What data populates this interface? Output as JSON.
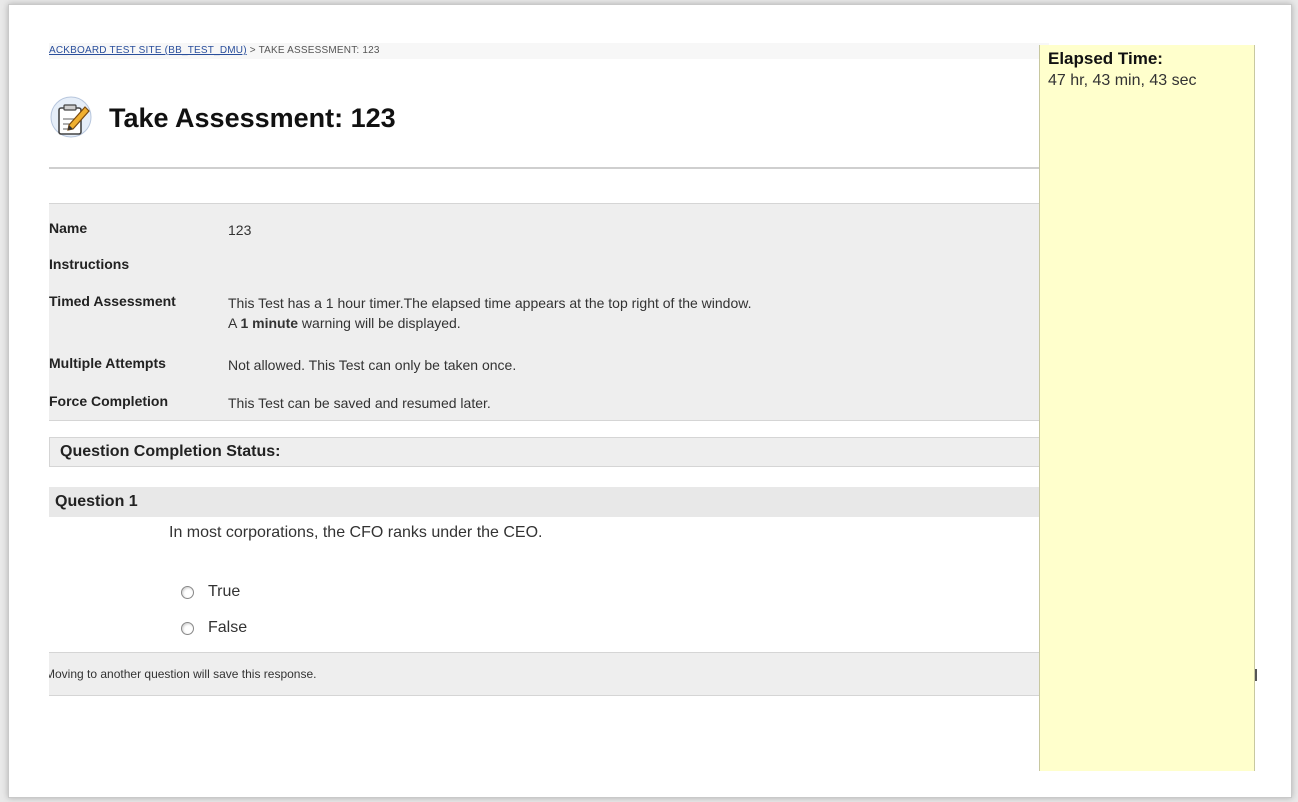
{
  "breadcrumb": {
    "course_link": "ACKBOARD TEST SITE (BB_TEST_DMU)",
    "separator": " > ",
    "current": "TAKE ASSESSMENT: 123"
  },
  "page": {
    "title": "Take Assessment: 123",
    "icon": "assessment-pencil-icon"
  },
  "info": {
    "name_label": "Name",
    "name_value": "123",
    "instructions_label": "Instructions",
    "instructions_value": "",
    "timed_label": "Timed Assessment",
    "timed_value_line1": "This Test has a 1 hour timer.The elapsed time appears at the top right of the window.",
    "timed_value_line2_prefix": "A ",
    "timed_value_line2_bold": "1 minute",
    "timed_value_line2_suffix": " warning will be displayed.",
    "attempts_label": "Multiple Attempts",
    "attempts_value": "Not allowed. This Test can only be taken once.",
    "force_label": "Force Completion",
    "force_value": "This Test can be saved and resumed later."
  },
  "question_completion_status": "Question Completion Status:",
  "question": {
    "header": "Question 1",
    "text": "In most corporations, the CFO ranks under the CEO.",
    "options": [
      "True",
      "False"
    ]
  },
  "save_notice": "Moving to another question will save this response.",
  "timer": {
    "label": "Elapsed Time:",
    "value": "47 hr, 43 min, 43 sec"
  },
  "colors": {
    "timer_background": "#ffffcc",
    "section_background": "#eeeeee",
    "link": "#2a4f9c"
  }
}
